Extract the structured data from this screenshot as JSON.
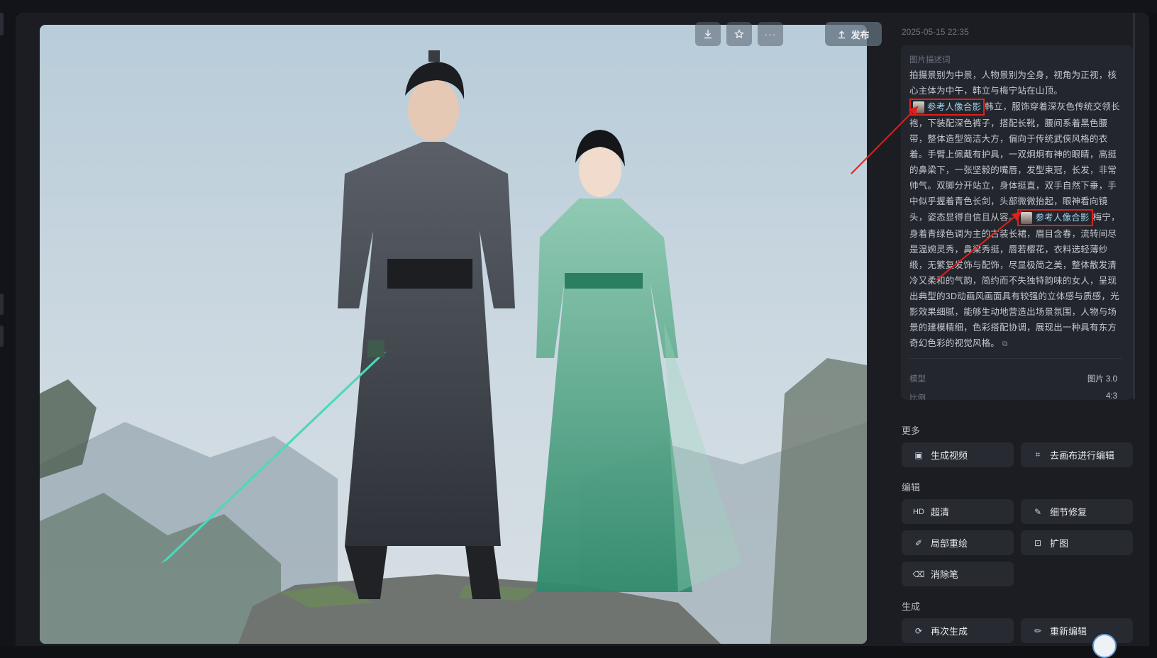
{
  "timestamp": "2025-05-15 22:35",
  "toolbar": {
    "download_icon": "download-icon",
    "favorite_icon": "star-icon",
    "more_icon": "more-dots-icon",
    "publish_label": "发布"
  },
  "description": {
    "label": "图片描述词",
    "part1": "拍摄景别为中景，人物景别为全身，视角为正视，核心主体为中午，韩立与梅宁站在山顶。",
    "ref1": "参考人像合影",
    "part2": "韩立，服饰穿着深灰色传统交领长袍，下装配深色裤子，搭配长靴，腰间系着黑色腰带，整体造型简洁大方，偏向于传统武侠风格的衣着。手臂上佩戴有护具，一双炯炯有神的眼睛，高挺的鼻梁下，一张坚毅的嘴唇，发型束冠，长发，非常帅气。双脚分开站立，身体挺直，双手自然下垂，手中似乎握着青色长剑，头部微微抬起，眼神看向镜头，姿态显得自信且从容。",
    "ref2": "参考人像合影",
    "part3": "梅宁，身着青绿色调为主的古装长裙，眉目含春，流转间尽是温婉灵秀，鼻梁秀挺，唇若樱花，衣料选轻薄纱缎，无繁复发饰与配饰，尽显极简之美，整体散发清冷又柔和的气韵，简约而不失独特韵味的女人，呈现出典型的3D动画风画面具有较强的立体感与质感，光影效果细腻，能够生动地营造出场景氛围，人物与场景的建模精细，色彩搭配协调，展现出一种具有东方奇幻色彩的视觉风格。"
  },
  "meta": {
    "model_label": "模型",
    "model_value": "图片 3.0",
    "ratio_label": "比例",
    "ratio_value": "4:3"
  },
  "sections": {
    "more": "更多",
    "edit": "编辑",
    "generate": "生成"
  },
  "buttons": {
    "gen_video": "生成视频",
    "canvas_edit": "去画布进行编辑",
    "hd_prefix": "HD",
    "hd": "超清",
    "detail_fix": "细节修复",
    "inpaint": "局部重绘",
    "expand": "扩图",
    "eraser": "消除笔",
    "regenerate": "再次生成",
    "reedit": "重新编辑"
  },
  "colors": {
    "accent_red": "#e0201c",
    "ref_text": "#9fd3ef",
    "panel_bg": "#1b1d23"
  }
}
